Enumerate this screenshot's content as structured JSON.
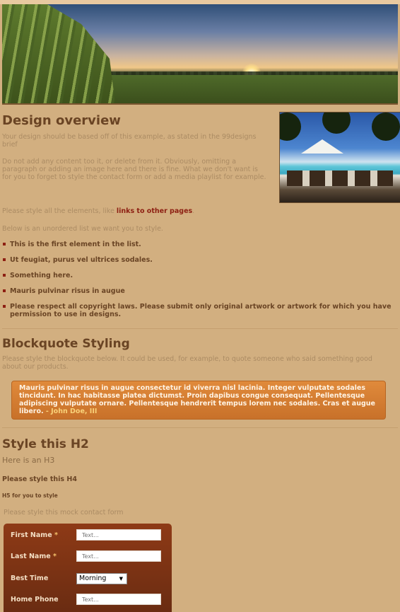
{
  "design_overview": {
    "title": "Design overview",
    "p1": "Your design should be based off of this example, as stated in the 99designs brief",
    "p2": "Do not add any content too it, or delete from it. Obviously, omitting a paragraph or adding an image here and there is fine. What we don't want is for you to forget to style the contact form or add a media playlist for example.",
    "p3_before": "Please style all the elements, like ",
    "p3_link": "links to other pages",
    "p3_after": ".",
    "p4": "Below is an unordered list we want you to style.",
    "list": [
      "This is the first element in the list.",
      "Ut feugiat, purus vel ultrices sodales.",
      "Something here.",
      "Mauris pulvinar risus in augue",
      "Please respect all copyright laws. Please submit only original artwork or artwork for which you have permission to use in designs."
    ]
  },
  "blockquote": {
    "title": "Blockquote Styling",
    "intro": "Please style the blockquote below. It could be used, for example, to quote someone who said something good about our products.",
    "text": "Mauris pulvinar risus in augue consectetur id viverra nisl lacinia. Integer vulputate sodales tincidunt. In hac habitasse platea dictumst. Proin dapibus congue consequat. Pellentesque adipiscing vulputate ornare. Pellentesque hendrerit tempus lorem nec sodales. Cras et augue libero.",
    "cite": " - John Doe, III"
  },
  "headings": {
    "h2": "Style this H2",
    "h3": "Here is an H3",
    "h4": "Please style this H4",
    "h5": "H5 for you to style"
  },
  "contact_form": {
    "intro": "Please style this mock contact form",
    "first_name_label": "First Name",
    "last_name_label": "Last Name",
    "required_mark": "*",
    "best_time_label": "Best Time",
    "best_time_value": "Morning",
    "home_phone_label": "Home Phone",
    "placeholder": "Text..."
  },
  "colors": {
    "background": "#d2af80",
    "link": "#8d1f12",
    "heading": "#6a4424",
    "quote_bg": "#d57c32",
    "form_bg": "#7d3314"
  }
}
